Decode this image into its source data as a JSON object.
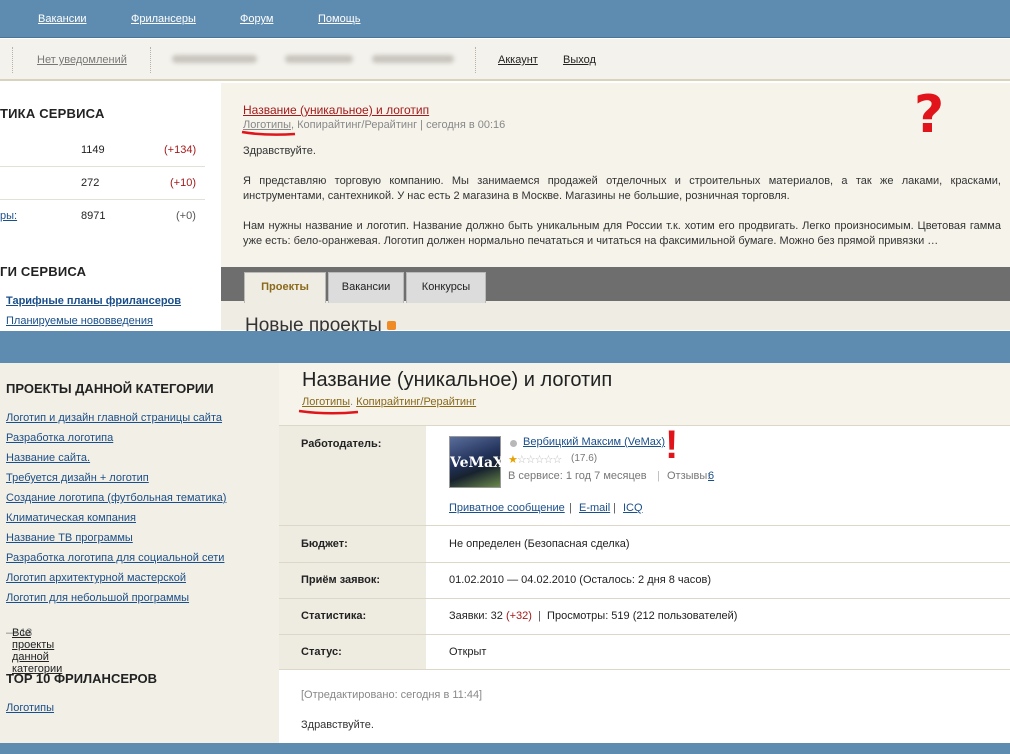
{
  "top_nav": {
    "links": [
      "Вакансии",
      "Фрилансеры",
      "Форум",
      "Помощь"
    ]
  },
  "sub_bar": {
    "notifications": "Нет уведомлений",
    "account": "Аккаунт",
    "logout": "Выход"
  },
  "stats": {
    "heading": "ТИКА СЕРВИСА",
    "rows": [
      {
        "label": "",
        "value": "1149",
        "delta": "(+134)"
      },
      {
        "label": "",
        "value": "272",
        "delta": "(+10)"
      },
      {
        "label": "ры:",
        "value": "8971",
        "delta": "(+0)"
      }
    ]
  },
  "services": {
    "heading": "ГИ СЕРВИСА",
    "links": [
      "Тарифные планы фрилансеров",
      "Планируемые нововведения"
    ]
  },
  "project_preview": {
    "title": "Название (уникальное) и логотип",
    "category_main": "Логотипы",
    "category_rest": ", Копирайтинг/Рерайтинг | сегодня в 00:16",
    "greeting": "Здравствуйте.",
    "para1": "Я представляю торговую компанию. Мы занимаемся продажей отделочных и строительных материалов, а так же лаками, красками, инструментами, сантехникой. У нас есть 2 магазина в Москве. Магазины не большие, розничная торговля.",
    "para2": "Нам нужны название и логотип. Название должно быть уникальным для России т.к. хотим его продвигать. Легко произносимым. Цветовая гамма уже есть: бело-оранжевая. Логотип должен нормально печататься и читаться на факсимильной бумаге. Можно без прямой привязки …"
  },
  "tabs": [
    "Проекты",
    "Вакансии",
    "Конкурсы"
  ],
  "new_projects_heading": "Новые проекты",
  "category_projects": {
    "heading": "ПРОЕКТЫ ДАННОЙ КАТЕГОРИИ",
    "links": [
      "Логотип и дизайн главной страницы сайта",
      "Разработка логотипа",
      "Название сайта.",
      "Требуется дизайн + логотип",
      "Создание логотипа (футбольная тематика)",
      "Климатическая компания",
      "Название ТВ программы",
      "Разработка логотипа для социальной сети",
      "Логотип архитектурной мастерской",
      "Логотип для небольшой программы"
    ],
    "all_link": "Все проекты данной категории",
    "all_count": "— 13"
  },
  "top10": {
    "heading": "TOP 10 ФРИЛАНСЕРОВ",
    "link": "Логотипы"
  },
  "project": {
    "title": "Название (уникальное) и логотип",
    "cat1": "Логотипы",
    "cat_sep": ". ",
    "cat2": "Копирайтинг/Рерайтинг"
  },
  "details": {
    "employer_label": "Работодатель:",
    "employer_name": "Вербицкий Максим (VeMax)",
    "rating": "(17.6)",
    "rating_stars": 1,
    "avatar_text": "VeMaX",
    "service_time": "В сервисе: 1 год 7 месяцев",
    "reviews_label": "Отзывы:",
    "reviews_count": "6",
    "private_msg": "Приватное сообщение",
    "email": "E-mail",
    "icq": "ICQ",
    "budget_label": "Бюджет:",
    "budget_value": "Не определен (Безопасная сделка)",
    "accept_label": "Приём заявок:",
    "accept_value": "01.02.2010 — 04.02.2010  (Осталось: 2 дня 8 часов)",
    "stats_label": "Статистика:",
    "stats_apps": "Заявки: 32",
    "stats_apps_delta": "(+32)",
    "stats_views": "Просмотры: 519 (212 пользователей)",
    "status_label": "Статус:",
    "status_value": "Открыт",
    "edited": "[Отредактировано: сегодня в 11:44]",
    "greeting": "Здравствуйте."
  },
  "annotations": {
    "question": "?",
    "exclaim": "!"
  },
  "colors": {
    "header_blue": "#5e8cb0",
    "accent_red": "#a31b1b",
    "link_blue": "#1a4f8a",
    "annotation_red": "#e0141a"
  }
}
